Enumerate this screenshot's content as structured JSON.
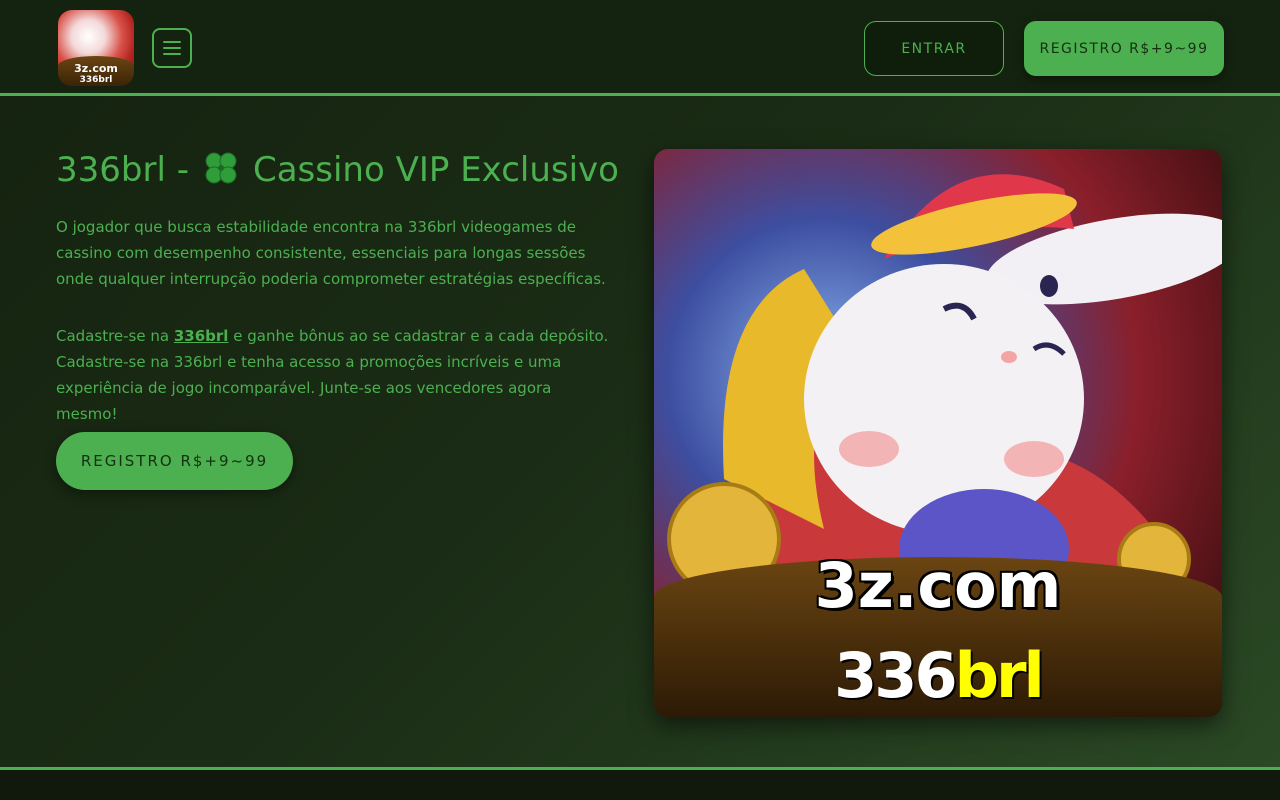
{
  "header": {
    "logo": {
      "line1": "3z.com",
      "line2": "336brl"
    },
    "menu_icon": "hamburger-menu-icon",
    "entrar_label": "ENTRAR",
    "registro_label": "REGISTRO R$+9~99"
  },
  "main": {
    "title_prefix": "336brl -",
    "title_icon": "four-leaf-clover-icon",
    "title_suffix": "Cassino VIP Exclusivo",
    "paragraph1": "O jogador que busca estabilidade encontra na 336brl videogames de cassino com desempenho consistente, essenciais para longas sessões onde qualquer interrupção poderia comprometer estratégias específicas.",
    "paragraph2_before": "Cadastre-se na",
    "paragraph2_link": "336brl",
    "paragraph2_after": "e ganhe bônus ao se cadastrar e a cada depósito. Cadastre-se na 336brl e tenha acesso a promoções incríveis e uma experiência de jogo incomparável. Junte-se aos vencedores agora mesmo!",
    "cta_label": "REGISTRO R$+9~99"
  },
  "hero": {
    "line1": "3z.com",
    "line2_number": "336",
    "line2_suffix": "brl"
  },
  "colors": {
    "accent": "#4caf50",
    "background": "#1b2d16",
    "header_bg": "#14230f",
    "brand_yellow": "#ffff00"
  }
}
